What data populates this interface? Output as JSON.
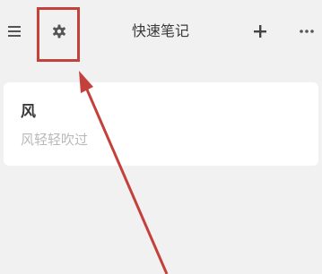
{
  "toolbar": {
    "title": "快速笔记",
    "menu_icon": "hamburger-menu-icon",
    "settings_icon": "gear-icon",
    "add_icon": "plus-icon",
    "more_icon": "more-horizontal-icon"
  },
  "notes": [
    {
      "title": "风",
      "preview": "风轻轻吹过"
    }
  ],
  "annotation": {
    "color": "#c4413b",
    "target": "settings-button"
  }
}
